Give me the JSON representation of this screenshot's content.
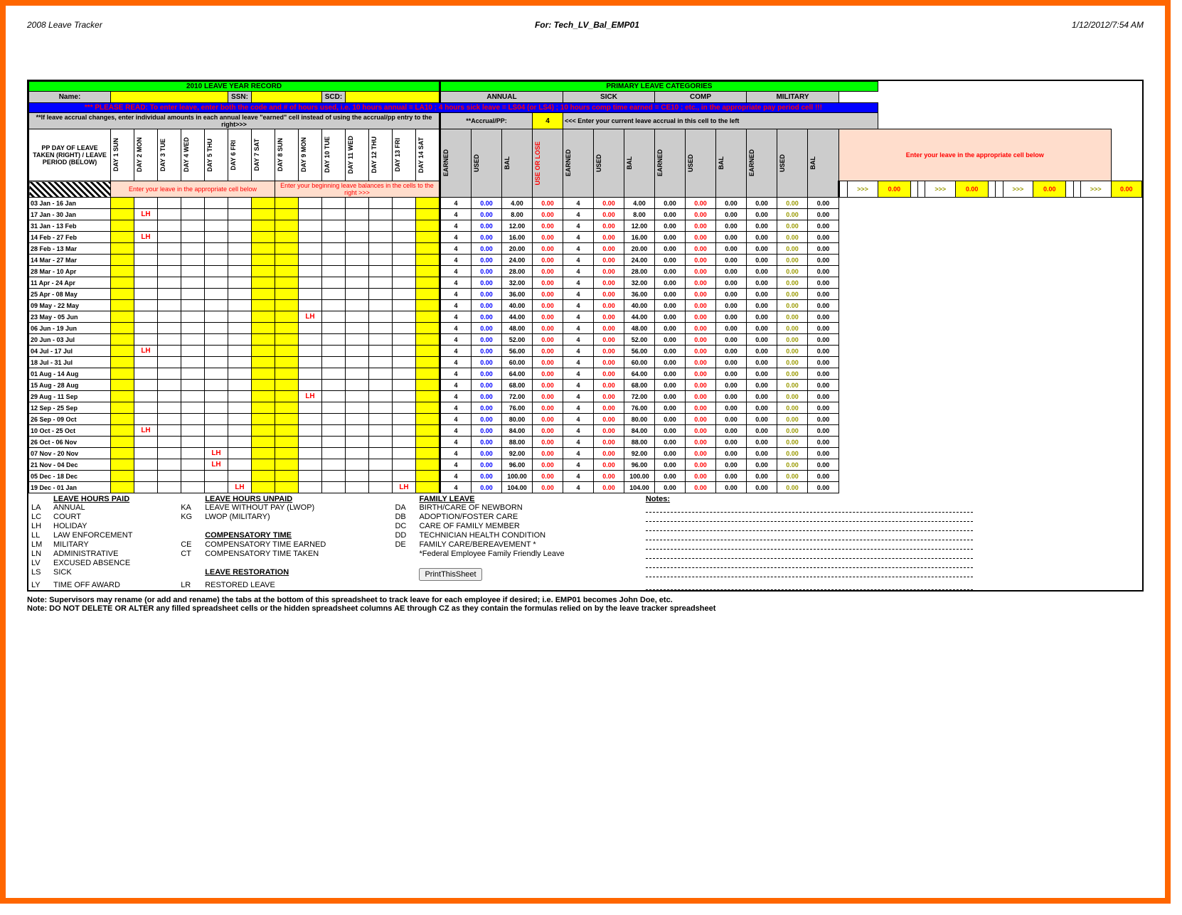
{
  "header": {
    "left": "2008 Leave Tracker",
    "center": "For: Tech_LV_Bal_EMP01",
    "right": "1/12/2012/7:54 AM"
  },
  "banner": {
    "title": "2010 LEAVE YEAR RECORD",
    "categories": "PRIMARY LEAVE CATEGORIES",
    "name_label": "Name:",
    "ssn_label": "SSN:",
    "scd_label": "SCD:",
    "read_note": "*** PLEASE READ: To enter leave, enter both the code and # of hours used, i.e. 10 hours annual = LA10 ; 4 hours sick leave = LS04 (or LS4) ; 10 hours comp time earned = CE10 ; etc., in the appropriate pay period cell !!!",
    "accrual_note": "**If leave accrual changes, enter individual amounts in each  annual leave \"earned\" cell instead of using the accrual/pp entry to the right>>>",
    "accrual_label": "**Accrual/PP:",
    "accrual_value": "4",
    "enter_balance_note": "<<< Enter your current leave accrual in this cell to the left"
  },
  "cats": {
    "annual": "ANNUAL",
    "sick": "SICK",
    "comp": "COMP",
    "military": "MILITARY",
    "earned": "EARNED",
    "used": "USED",
    "bal": "BAL",
    "use_or_lose": "USE OR LOSE"
  },
  "row_header": {
    "pp": "PP DAY OF LEAVE TAKEN (RIGHT) / LEAVE PERIOD (BELOW)",
    "days": [
      "DAY 1 SUN",
      "DAY 2 MON",
      "DAY 3 TUE",
      "DAY 4 WED",
      "DAY 5 THU",
      "DAY 6 FRI",
      "DAY 7 SAT",
      "DAY 8 SUN",
      "DAY 9 MON",
      "DAY 10 TUE",
      "DAY 11 WED",
      "DAY 12 THU",
      "DAY 13 FRI",
      "DAY 14 SAT"
    ],
    "enter_leave": "Enter your leave in the appropriate cell below",
    "enter_balance": "Enter your beginning leave balances in the cells to the right >>>",
    "init_bal": [
      "",
      ">>>",
      "0.00",
      "",
      "",
      ">>>",
      "0.00",
      "",
      "",
      ">>>",
      "0.00",
      "",
      "",
      ">>>",
      "0.00"
    ]
  },
  "periods": [
    {
      "label": "03 Jan - 16 Jan",
      "lh": [],
      "annual": [
        "4",
        "0.00",
        "4.00",
        "0.00"
      ],
      "sick": [
        "4",
        "0.00",
        "4.00"
      ],
      "comp": [
        "0.00",
        "0.00",
        "0.00"
      ],
      "mil": [
        "0.00",
        "0.00",
        "0.00"
      ]
    },
    {
      "label": "17 Jan - 30 Jan",
      "lh": [
        2
      ],
      "annual": [
        "4",
        "0.00",
        "8.00",
        "0.00"
      ],
      "sick": [
        "4",
        "0.00",
        "8.00"
      ],
      "comp": [
        "0.00",
        "0.00",
        "0.00"
      ],
      "mil": [
        "0.00",
        "0.00",
        "0.00"
      ]
    },
    {
      "label": "31 Jan - 13 Feb",
      "lh": [],
      "annual": [
        "4",
        "0.00",
        "12.00",
        "0.00"
      ],
      "sick": [
        "4",
        "0.00",
        "12.00"
      ],
      "comp": [
        "0.00",
        "0.00",
        "0.00"
      ],
      "mil": [
        "0.00",
        "0.00",
        "0.00"
      ]
    },
    {
      "label": "14 Feb - 27 Feb",
      "lh": [
        2
      ],
      "annual": [
        "4",
        "0.00",
        "16.00",
        "0.00"
      ],
      "sick": [
        "4",
        "0.00",
        "16.00"
      ],
      "comp": [
        "0.00",
        "0.00",
        "0.00"
      ],
      "mil": [
        "0.00",
        "0.00",
        "0.00"
      ]
    },
    {
      "label": "28 Feb - 13 Mar",
      "lh": [],
      "annual": [
        "4",
        "0.00",
        "20.00",
        "0.00"
      ],
      "sick": [
        "4",
        "0.00",
        "20.00"
      ],
      "comp": [
        "0.00",
        "0.00",
        "0.00"
      ],
      "mil": [
        "0.00",
        "0.00",
        "0.00"
      ]
    },
    {
      "label": "14 Mar - 27 Mar",
      "lh": [],
      "annual": [
        "4",
        "0.00",
        "24.00",
        "0.00"
      ],
      "sick": [
        "4",
        "0.00",
        "24.00"
      ],
      "comp": [
        "0.00",
        "0.00",
        "0.00"
      ],
      "mil": [
        "0.00",
        "0.00",
        "0.00"
      ]
    },
    {
      "label": "28 Mar - 10 Apr",
      "lh": [],
      "annual": [
        "4",
        "0.00",
        "28.00",
        "0.00"
      ],
      "sick": [
        "4",
        "0.00",
        "28.00"
      ],
      "comp": [
        "0.00",
        "0.00",
        "0.00"
      ],
      "mil": [
        "0.00",
        "0.00",
        "0.00"
      ]
    },
    {
      "label": "11 Apr - 24 Apr",
      "lh": [],
      "annual": [
        "4",
        "0.00",
        "32.00",
        "0.00"
      ],
      "sick": [
        "4",
        "0.00",
        "32.00"
      ],
      "comp": [
        "0.00",
        "0.00",
        "0.00"
      ],
      "mil": [
        "0.00",
        "0.00",
        "0.00"
      ]
    },
    {
      "label": "25 Apr - 08 May",
      "lh": [],
      "annual": [
        "4",
        "0.00",
        "36.00",
        "0.00"
      ],
      "sick": [
        "4",
        "0.00",
        "36.00"
      ],
      "comp": [
        "0.00",
        "0.00",
        "0.00"
      ],
      "mil": [
        "0.00",
        "0.00",
        "0.00"
      ]
    },
    {
      "label": "09 May - 22 May",
      "lh": [],
      "annual": [
        "4",
        "0.00",
        "40.00",
        "0.00"
      ],
      "sick": [
        "4",
        "0.00",
        "40.00"
      ],
      "comp": [
        "0.00",
        "0.00",
        "0.00"
      ],
      "mil": [
        "0.00",
        "0.00",
        "0.00"
      ]
    },
    {
      "label": "23 May - 05 Jun",
      "lh": [
        9
      ],
      "annual": [
        "4",
        "0.00",
        "44.00",
        "0.00"
      ],
      "sick": [
        "4",
        "0.00",
        "44.00"
      ],
      "comp": [
        "0.00",
        "0.00",
        "0.00"
      ],
      "mil": [
        "0.00",
        "0.00",
        "0.00"
      ]
    },
    {
      "label": "06 Jun - 19 Jun",
      "lh": [],
      "annual": [
        "4",
        "0.00",
        "48.00",
        "0.00"
      ],
      "sick": [
        "4",
        "0.00",
        "48.00"
      ],
      "comp": [
        "0.00",
        "0.00",
        "0.00"
      ],
      "mil": [
        "0.00",
        "0.00",
        "0.00"
      ]
    },
    {
      "label": "20 Jun - 03 Jul",
      "lh": [],
      "annual": [
        "4",
        "0.00",
        "52.00",
        "0.00"
      ],
      "sick": [
        "4",
        "0.00",
        "52.00"
      ],
      "comp": [
        "0.00",
        "0.00",
        "0.00"
      ],
      "mil": [
        "0.00",
        "0.00",
        "0.00"
      ]
    },
    {
      "label": "04 Jul - 17 Jul",
      "lh": [
        2
      ],
      "annual": [
        "4",
        "0.00",
        "56.00",
        "0.00"
      ],
      "sick": [
        "4",
        "0.00",
        "56.00"
      ],
      "comp": [
        "0.00",
        "0.00",
        "0.00"
      ],
      "mil": [
        "0.00",
        "0.00",
        "0.00"
      ]
    },
    {
      "label": "18 Jul - 31 Jul",
      "lh": [],
      "annual": [
        "4",
        "0.00",
        "60.00",
        "0.00"
      ],
      "sick": [
        "4",
        "0.00",
        "60.00"
      ],
      "comp": [
        "0.00",
        "0.00",
        "0.00"
      ],
      "mil": [
        "0.00",
        "0.00",
        "0.00"
      ]
    },
    {
      "label": "01 Aug - 14 Aug",
      "lh": [],
      "annual": [
        "4",
        "0.00",
        "64.00",
        "0.00"
      ],
      "sick": [
        "4",
        "0.00",
        "64.00"
      ],
      "comp": [
        "0.00",
        "0.00",
        "0.00"
      ],
      "mil": [
        "0.00",
        "0.00",
        "0.00"
      ]
    },
    {
      "label": "15 Aug - 28 Aug",
      "lh": [],
      "annual": [
        "4",
        "0.00",
        "68.00",
        "0.00"
      ],
      "sick": [
        "4",
        "0.00",
        "68.00"
      ],
      "comp": [
        "0.00",
        "0.00",
        "0.00"
      ],
      "mil": [
        "0.00",
        "0.00",
        "0.00"
      ]
    },
    {
      "label": "29 Aug - 11 Sep",
      "lh": [
        9
      ],
      "annual": [
        "4",
        "0.00",
        "72.00",
        "0.00"
      ],
      "sick": [
        "4",
        "0.00",
        "72.00"
      ],
      "comp": [
        "0.00",
        "0.00",
        "0.00"
      ],
      "mil": [
        "0.00",
        "0.00",
        "0.00"
      ]
    },
    {
      "label": "12 Sep - 25 Sep",
      "lh": [],
      "annual": [
        "4",
        "0.00",
        "76.00",
        "0.00"
      ],
      "sick": [
        "4",
        "0.00",
        "76.00"
      ],
      "comp": [
        "0.00",
        "0.00",
        "0.00"
      ],
      "mil": [
        "0.00",
        "0.00",
        "0.00"
      ]
    },
    {
      "label": "26 Sep - 09 Oct",
      "lh": [],
      "annual": [
        "4",
        "0.00",
        "80.00",
        "0.00"
      ],
      "sick": [
        "4",
        "0.00",
        "80.00"
      ],
      "comp": [
        "0.00",
        "0.00",
        "0.00"
      ],
      "mil": [
        "0.00",
        "0.00",
        "0.00"
      ]
    },
    {
      "label": "10 Oct - 25 Oct",
      "lh": [
        2
      ],
      "annual": [
        "4",
        "0.00",
        "84.00",
        "0.00"
      ],
      "sick": [
        "4",
        "0.00",
        "84.00"
      ],
      "comp": [
        "0.00",
        "0.00",
        "0.00"
      ],
      "mil": [
        "0.00",
        "0.00",
        "0.00"
      ]
    },
    {
      "label": "26 Oct - 06 Nov",
      "lh": [],
      "annual": [
        "4",
        "0.00",
        "88.00",
        "0.00"
      ],
      "sick": [
        "4",
        "0.00",
        "88.00"
      ],
      "comp": [
        "0.00",
        "0.00",
        "0.00"
      ],
      "mil": [
        "0.00",
        "0.00",
        "0.00"
      ]
    },
    {
      "label": "07 Nov - 20 Nov",
      "lh": [
        5
      ],
      "annual": [
        "4",
        "0.00",
        "92.00",
        "0.00"
      ],
      "sick": [
        "4",
        "0.00",
        "92.00"
      ],
      "comp": [
        "0.00",
        "0.00",
        "0.00"
      ],
      "mil": [
        "0.00",
        "0.00",
        "0.00"
      ]
    },
    {
      "label": "21 Nov - 04 Dec",
      "lh": [
        5
      ],
      "annual": [
        "4",
        "0.00",
        "96.00",
        "0.00"
      ],
      "sick": [
        "4",
        "0.00",
        "96.00"
      ],
      "comp": [
        "0.00",
        "0.00",
        "0.00"
      ],
      "mil": [
        "0.00",
        "0.00",
        "0.00"
      ]
    },
    {
      "label": "05 Dec - 18 Dec",
      "lh": [],
      "annual": [
        "4",
        "0.00",
        "100.00",
        "0.00"
      ],
      "sick": [
        "4",
        "0.00",
        "100.00"
      ],
      "comp": [
        "0.00",
        "0.00",
        "0.00"
      ],
      "mil": [
        "0.00",
        "0.00",
        "0.00"
      ]
    },
    {
      "label": "19 Dec - 01 Jan",
      "lh": [
        6,
        13
      ],
      "annual": [
        "4",
        "0.00",
        "104.00",
        "0.00"
      ],
      "sick": [
        "4",
        "0.00",
        "104.00"
      ],
      "comp": [
        "0.00",
        "0.00",
        "0.00"
      ],
      "mil": [
        "0.00",
        "0.00",
        "0.00"
      ]
    }
  ],
  "legend": {
    "paid": {
      "title": "LEAVE HOURS PAID",
      "rows": [
        [
          "LA",
          "ANNUAL"
        ],
        [
          "LC",
          "COURT"
        ],
        [
          "LH",
          "HOLIDAY"
        ],
        [
          "LL",
          "LAW ENFORCEMENT"
        ],
        [
          "LM",
          "MILITARY"
        ],
        [
          "LN",
          "ADMINISTRATIVE"
        ],
        [
          "LV",
          "EXCUSED ABSENCE"
        ],
        [
          "LS",
          "SICK"
        ],
        [
          "LY",
          "TIME OFF AWARD"
        ]
      ]
    },
    "unpaid": {
      "title": "LEAVE HOURS UNPAID",
      "rows": [
        [
          "KA",
          "LEAVE WITHOUT PAY (LWOP)"
        ],
        [
          "KG",
          "LWOP (MILITARY)"
        ]
      ]
    },
    "comp": {
      "title": "COMPENSATORY TIME",
      "rows": [
        [
          "CE",
          "COMPENSATORY TIME EARNED"
        ],
        [
          "CT",
          "COMPENSATORY TIME TAKEN"
        ]
      ]
    },
    "restore": {
      "title": "LEAVE RESTORATION",
      "rows": [
        [
          "LR",
          "RESTORED LEAVE"
        ]
      ]
    },
    "family": {
      "title": "FAMILY LEAVE",
      "rows": [
        [
          "DA",
          "BIRTH/CARE OF NEWBORN"
        ],
        [
          "DB",
          "ADOPTION/FOSTER CARE"
        ],
        [
          "DC",
          "CARE OF FAMILY MEMBER"
        ],
        [
          "DD",
          "TECHNICIAN HEALTH CONDITION"
        ],
        [
          "DE",
          "FAMILY CARE/BEREAVEMENT *"
        ],
        [
          "",
          "*Federal Employee Family Friendly Leave"
        ]
      ]
    },
    "notes_label": "Notes:",
    "button": "PrintThisSheet"
  },
  "notes": [
    "Note:  Supervisors may rename (or add and rename) the tabs at the bottom of this spreadsheet to track leave for each employee if desired; i.e. EMP01 becomes John Doe, etc.",
    "Note: DO NOT DELETE OR ALTER any filled spreadsheet cells or the hidden spreadsheet columns AE through CZ as they contain the formulas relied on by the leave tracker spreadsheet"
  ],
  "lh_text": "LH"
}
